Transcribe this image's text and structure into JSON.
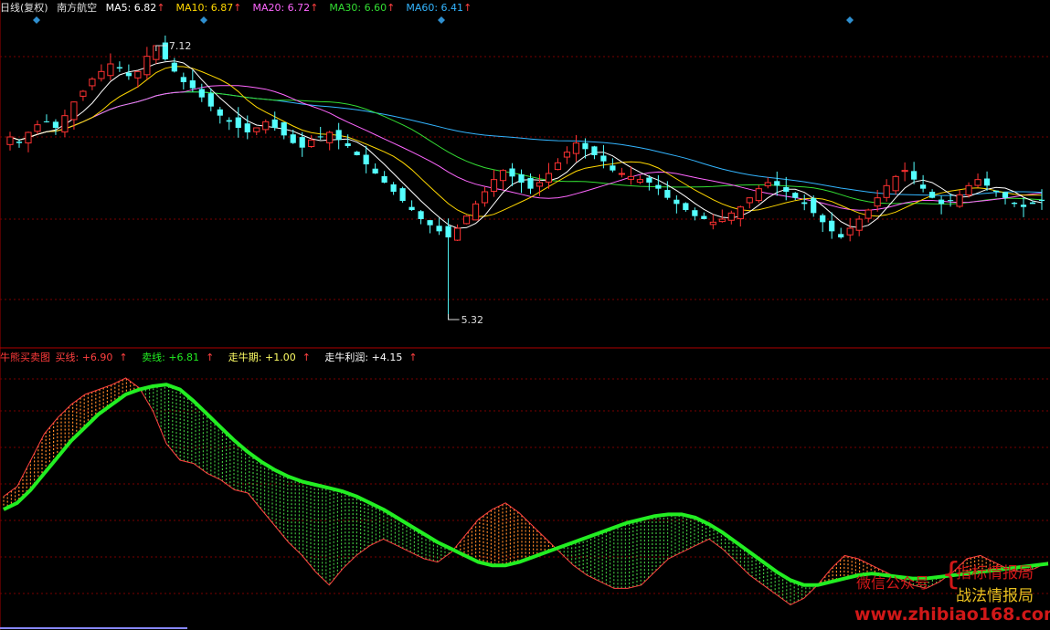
{
  "colors": {
    "background": "#000000",
    "grid": "#7a0000",
    "candle_up": "#ff3232",
    "candle_down": "#54ffff",
    "ma5": "#ffffff",
    "ma10": "#ffd700",
    "ma20": "#ff66ff",
    "ma30": "#33dd33",
    "ma60": "#33b5ff",
    "buy_line": "#ff4040",
    "sell_line": "#22ee22",
    "bull_period": "#ffff66",
    "bull_profit": "#ffffff"
  },
  "price_panel": {
    "period": "日线(复权)",
    "stock": "南方航空",
    "ma": [
      {
        "label": "MA5: 6.82",
        "color": "#ffffff"
      },
      {
        "label": "MA10: 6.87",
        "color": "#ffd700"
      },
      {
        "label": "MA20: 6.72",
        "color": "#ff66ff"
      },
      {
        "label": "MA30: 6.60",
        "color": "#33dd33"
      },
      {
        "label": "MA60: 6.41",
        "color": "#33b5ff"
      }
    ],
    "arrow": "↑",
    "high_label": "7.12",
    "low_label": "5.32"
  },
  "indicator_panel": {
    "name": "牛熊买卖图",
    "buy": "买线: +6.90",
    "sell": "卖线: +6.81",
    "period": "走牛期: +1.00",
    "profit": "走牛利润: +4.15",
    "arrow": "↑"
  },
  "watermark": {
    "label": "微信公众号",
    "brace": "{",
    "line1": "指标情报局",
    "line2": "战法情报局",
    "url": "www.zhibiao168.com"
  },
  "chart_data": [
    {
      "type": "candlestick",
      "title": "南方航空 日线(复权)",
      "price_axis_reference": {
        "high_marker": 7.12,
        "low_marker": 5.32
      },
      "close_series": [
        6.52,
        6.48,
        6.55,
        6.6,
        6.62,
        6.58,
        6.66,
        6.75,
        6.82,
        6.9,
        6.95,
        7.0,
        6.97,
        6.92,
        6.95,
        7.05,
        7.12,
        7.03,
        6.95,
        6.88,
        6.84,
        6.78,
        6.72,
        6.66,
        6.62,
        6.58,
        6.55,
        6.58,
        6.62,
        6.58,
        6.53,
        6.48,
        6.45,
        6.5,
        6.52,
        6.55,
        6.5,
        6.46,
        6.4,
        6.34,
        6.28,
        6.22,
        6.16,
        6.1,
        6.04,
        5.98,
        5.94,
        5.9,
        5.86,
        5.92,
        6.0,
        6.08,
        6.16,
        6.24,
        6.3,
        6.26,
        6.22,
        6.18,
        6.22,
        6.28,
        6.35,
        6.42,
        6.48,
        6.44,
        6.4,
        6.36,
        6.3,
        6.28,
        6.26,
        6.24,
        6.22,
        6.18,
        6.12,
        6.08,
        6.04,
        6.0,
        5.98,
        5.96,
        5.98,
        6.02,
        6.06,
        6.12,
        6.18,
        6.22,
        6.2,
        6.16,
        6.12,
        6.08,
        6.02,
        5.96,
        5.9,
        5.86,
        5.92,
        5.98,
        6.04,
        6.12,
        6.2,
        6.26,
        6.3,
        6.24,
        6.18,
        6.12,
        6.08,
        6.1,
        6.14,
        6.2,
        6.24,
        6.2,
        6.16,
        6.12,
        6.08,
        6.06,
        6.08,
        6.1
      ],
      "ma_latest": {
        "MA5": 6.82,
        "MA10": 6.87,
        "MA20": 6.72,
        "MA30": 6.6,
        "MA60": 6.41
      },
      "xlabel": "",
      "ylabel": ""
    },
    {
      "type": "line",
      "title": "牛熊买卖图",
      "series": [
        {
          "name": "买线",
          "latest": 6.9
        },
        {
          "name": "卖线",
          "latest": 6.81
        }
      ],
      "sell_line_values": [
        6.2,
        6.24,
        6.32,
        6.42,
        6.52,
        6.62,
        6.7,
        6.78,
        6.84,
        6.9,
        6.93,
        6.95,
        6.96,
        6.93,
        6.86,
        6.78,
        6.7,
        6.62,
        6.55,
        6.49,
        6.44,
        6.4,
        6.37,
        6.35,
        6.33,
        6.31,
        6.28,
        6.24,
        6.2,
        6.15,
        6.1,
        6.05,
        6.0,
        5.96,
        5.92,
        5.88,
        5.86,
        5.86,
        5.88,
        5.91,
        5.94,
        5.97,
        6.0,
        6.03,
        6.06,
        6.09,
        6.12,
        6.14,
        6.16,
        6.17,
        6.17,
        6.15,
        6.11,
        6.06,
        6.0,
        5.94,
        5.88,
        5.82,
        5.77,
        5.74,
        5.74,
        5.76,
        5.78,
        5.8,
        5.81,
        5.8,
        5.79,
        5.78,
        5.78,
        5.79,
        5.8,
        5.81,
        5.82,
        5.83,
        5.84,
        5.85,
        5.86,
        5.87
      ],
      "buy_line_values": [
        6.28,
        6.34,
        6.5,
        6.66,
        6.76,
        6.84,
        6.9,
        6.93,
        6.96,
        7.0,
        6.94,
        6.8,
        6.6,
        6.5,
        6.48,
        6.42,
        6.38,
        6.32,
        6.3,
        6.2,
        6.1,
        6.0,
        5.92,
        5.82,
        5.74,
        5.84,
        5.92,
        5.98,
        6.02,
        5.98,
        5.94,
        5.9,
        5.88,
        5.94,
        6.04,
        6.14,
        6.2,
        6.24,
        6.18,
        6.1,
        6.02,
        5.94,
        5.86,
        5.8,
        5.76,
        5.72,
        5.72,
        5.74,
        5.82,
        5.9,
        5.94,
        5.98,
        6.02,
        5.96,
        5.88,
        5.8,
        5.74,
        5.68,
        5.62,
        5.66,
        5.74,
        5.84,
        5.92,
        5.9,
        5.86,
        5.82,
        5.78,
        5.74,
        5.72,
        5.76,
        5.82,
        5.9,
        5.92,
        5.88,
        5.84,
        5.82,
        5.84,
        5.88
      ]
    }
  ]
}
